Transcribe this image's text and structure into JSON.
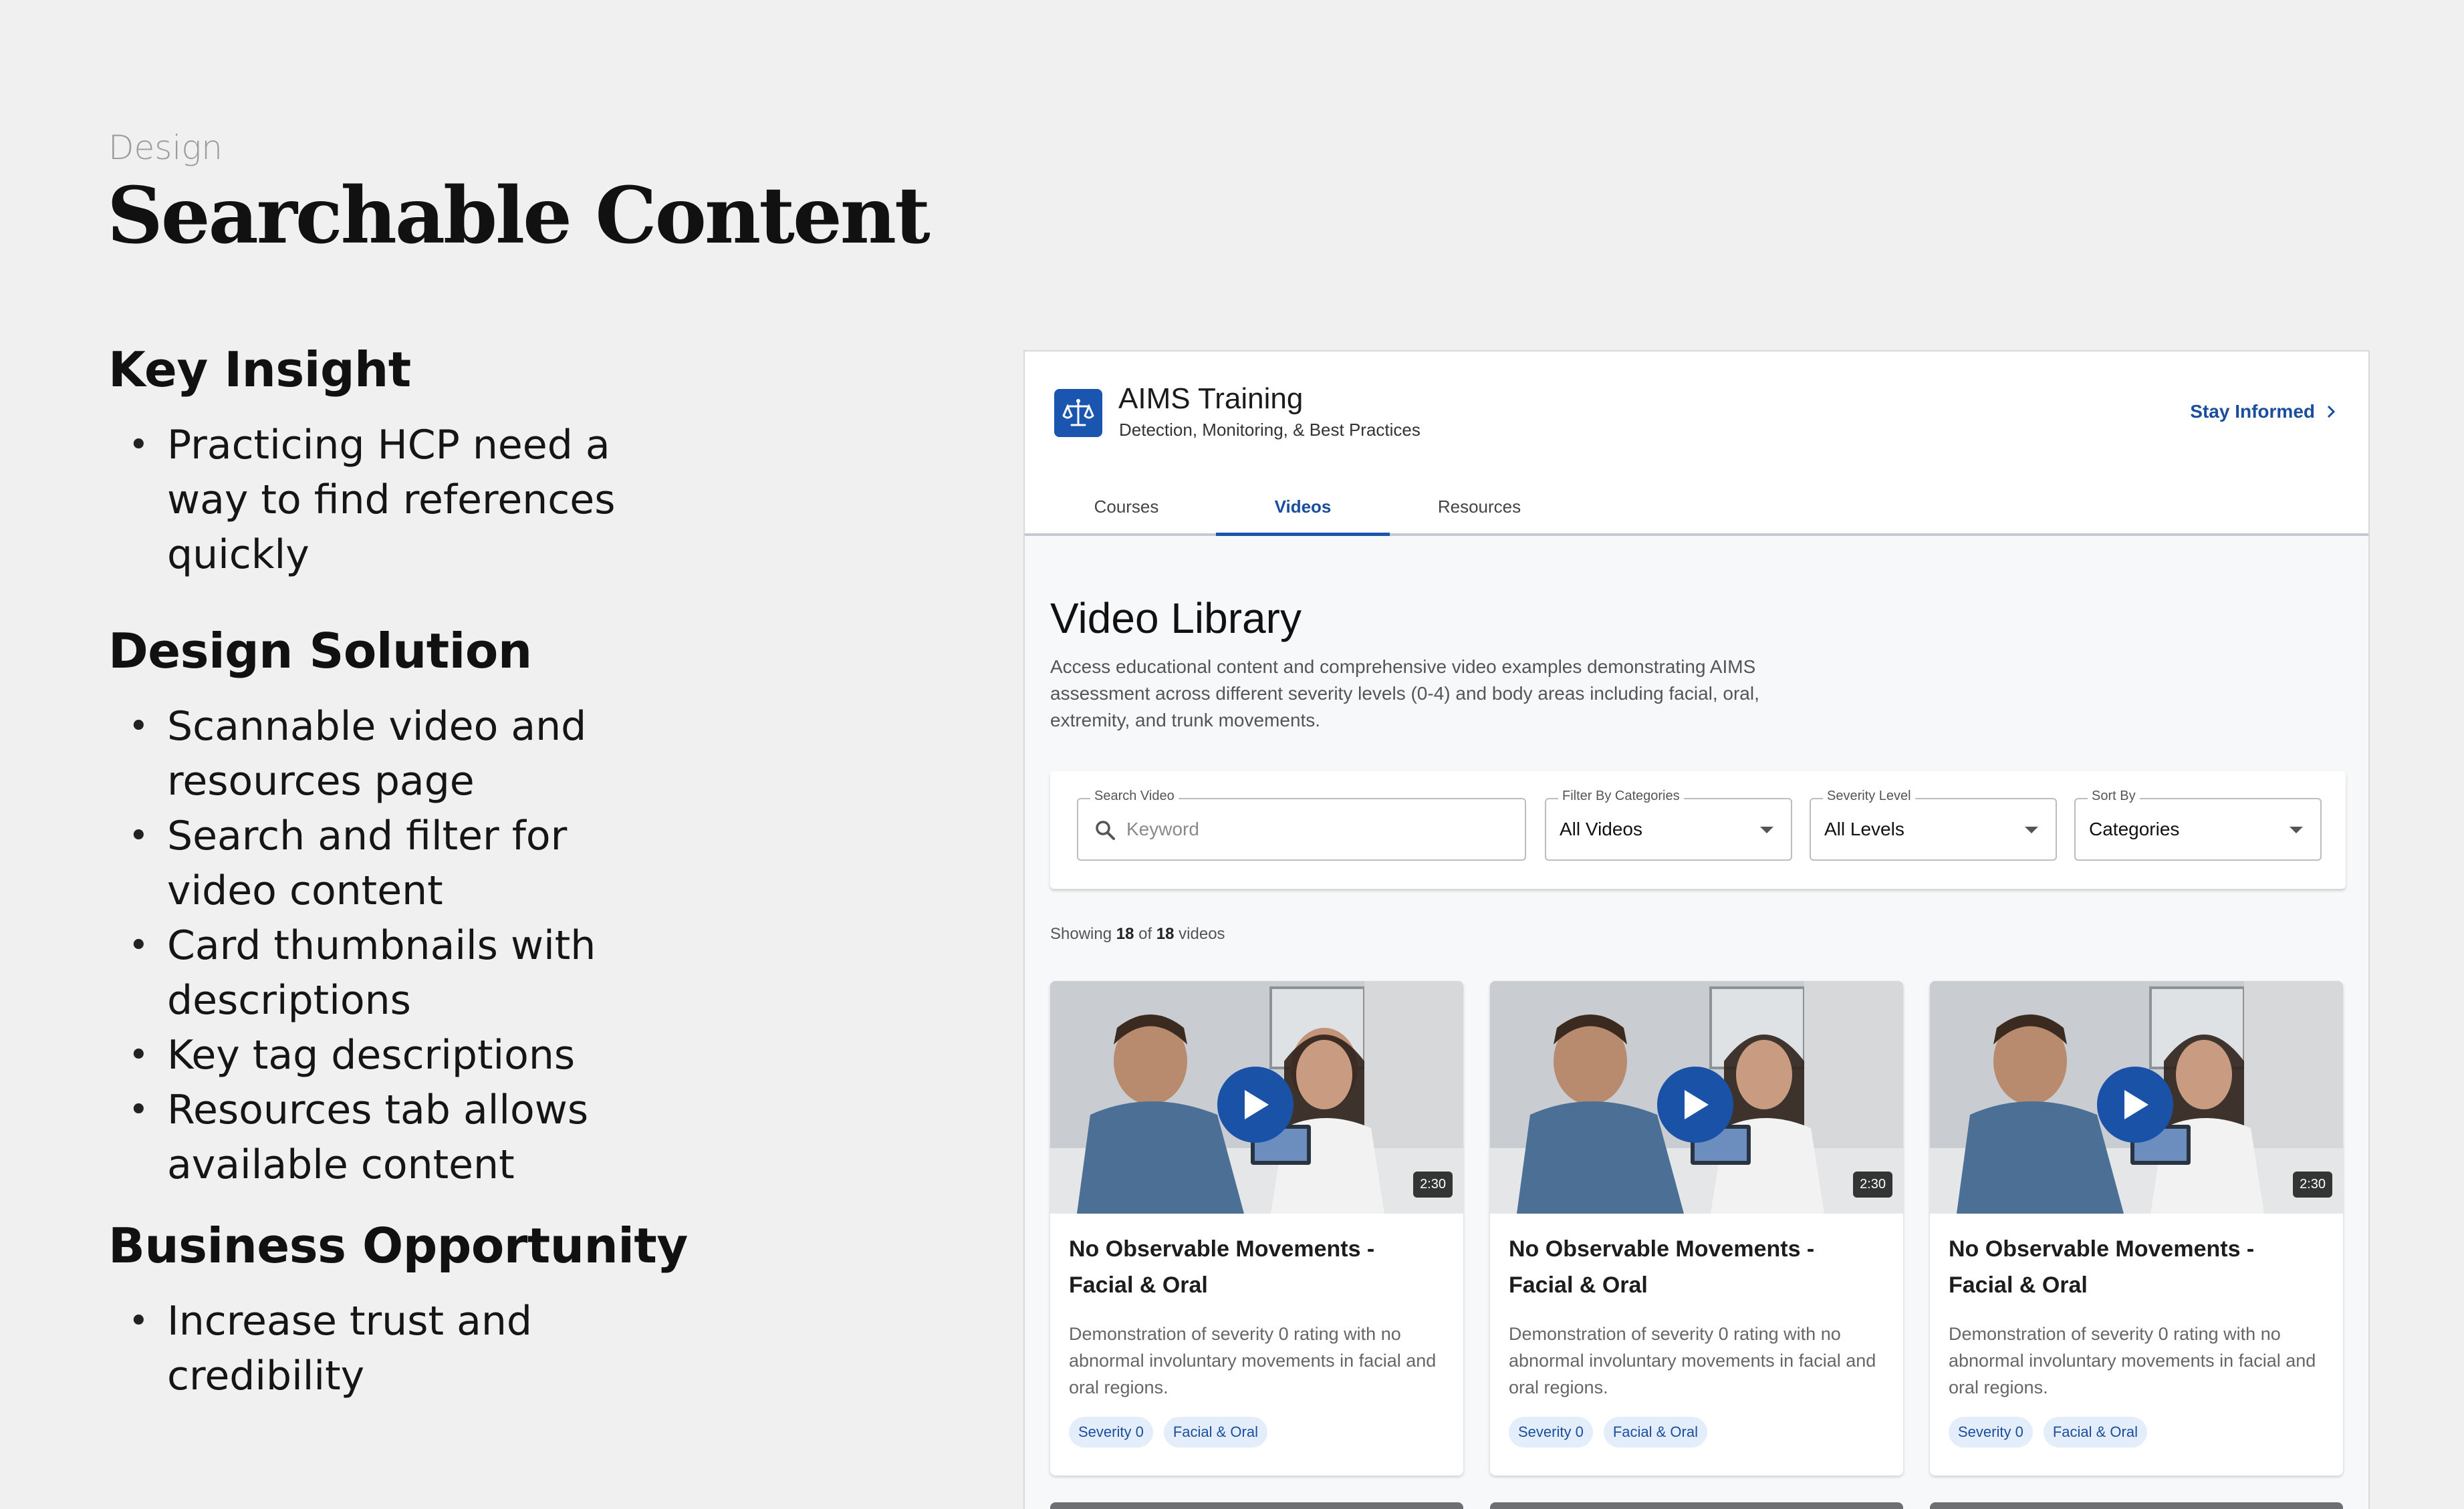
{
  "slide": {
    "eyebrow": "Design",
    "title": "Searchable Content",
    "sections": [
      {
        "heading": "Key Insight",
        "bullets": [
          "Practicing HCP need a way to find references quickly"
        ]
      },
      {
        "heading": "Design Solution",
        "bullets": [
          "Scannable video and resources page",
          "Search and filter for video content",
          "Card thumbnails with descriptions",
          "Key tag descriptions",
          "Resources tab allows available content"
        ]
      },
      {
        "heading": "Business Opportunity",
        "bullets": [
          "Increase trust and credibility"
        ]
      }
    ]
  },
  "app": {
    "logo_icon": "scales-icon",
    "name": "AIMS Training",
    "subtitle": "Detection, Monitoring, & Best Practices",
    "stay_informed": "Stay Informed",
    "tabs": [
      {
        "label": "Courses",
        "active": false
      },
      {
        "label": "Videos",
        "active": true
      },
      {
        "label": "Resources",
        "active": false
      }
    ],
    "library": {
      "title": "Video Library",
      "description": "Access educational content and comprehensive video examples demonstrating AIMS assessment across different severity levels (0-4) and body areas including facial, oral, extremity, and trunk movements."
    },
    "filters": {
      "search": {
        "label": "Search Video",
        "placeholder": "Keyword"
      },
      "category": {
        "label": "Filter By Categories",
        "value": "All Videos"
      },
      "severity": {
        "label": "Severity Level",
        "value": "All Levels"
      },
      "sort": {
        "label": "Sort By",
        "value": "Categories"
      }
    },
    "showing": {
      "prefix": "Showing",
      "shown": "18",
      "of": "of",
      "total": "18",
      "suffix": "videos"
    },
    "cards": [
      {
        "duration": "2:30",
        "title": "No Observable Movements - Facial & Oral",
        "description": "Demonstration of severity 0 rating with no abnormal involuntary movements in facial and oral regions.",
        "tags": [
          "Severity 0",
          "Facial & Oral"
        ]
      },
      {
        "duration": "2:30",
        "title": "No Observable Movements - Facial & Oral",
        "description": "Demonstration of severity 0 rating with no abnormal involuntary movements in facial and oral regions.",
        "tags": [
          "Severity 0",
          "Facial & Oral"
        ]
      },
      {
        "duration": "2:30",
        "title": "No Observable Movements - Facial & Oral",
        "description": "Demonstration of severity 0 rating with no abnormal involuntary movements in facial and oral regions.",
        "tags": [
          "Severity 0",
          "Facial & Oral"
        ]
      }
    ],
    "colors": {
      "brand": "#1a55b0",
      "link": "#1a4d9c",
      "tag_bg": "#e4eefb"
    }
  }
}
